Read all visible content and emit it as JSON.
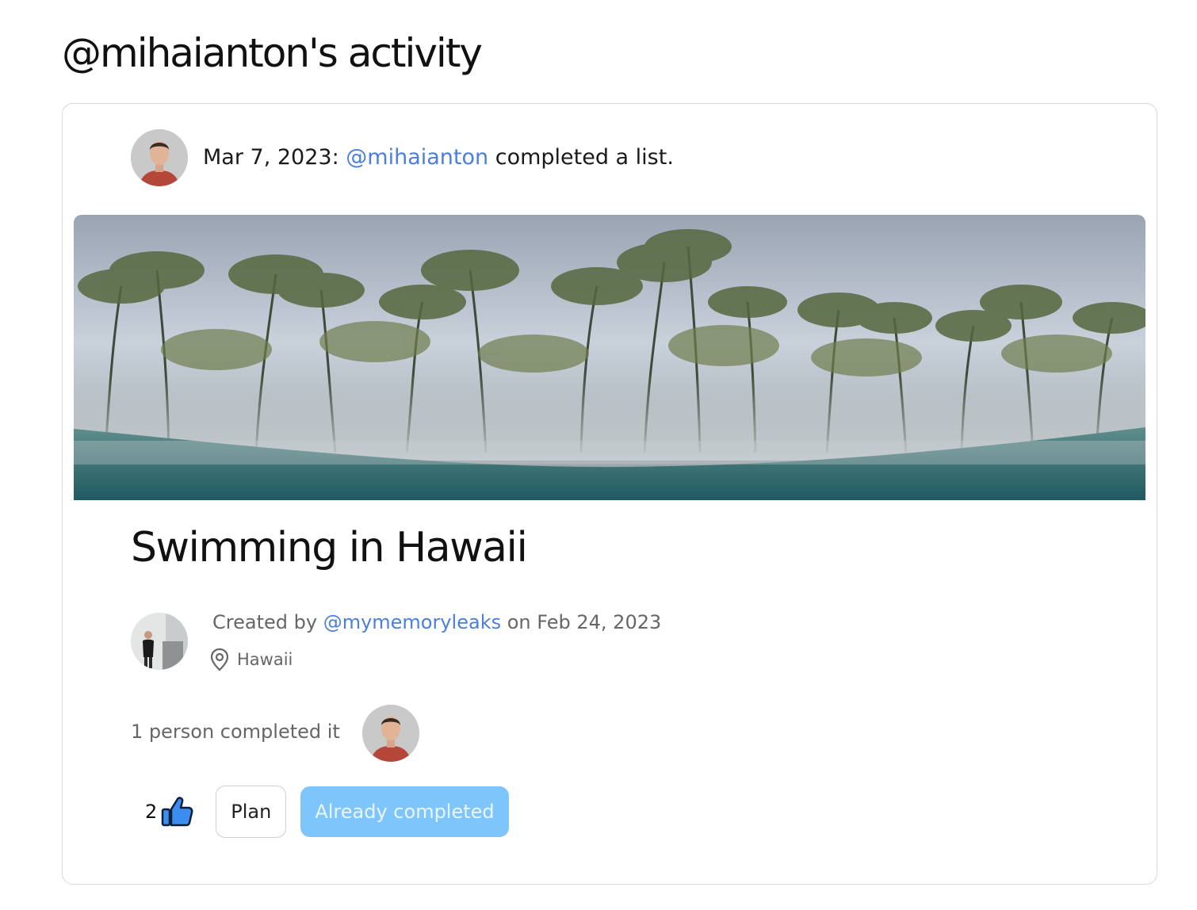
{
  "page": {
    "title": "@mihaianton's activity"
  },
  "activity": {
    "date": "Mar 7, 2023:",
    "user": "@mihaianton",
    "action": "completed a list."
  },
  "list": {
    "title": "Swimming in Hawaii",
    "created_prefix": "Created by",
    "creator": "@mymemoryleaks",
    "created_suffix": "on Feb 24, 2023",
    "location": "Hawaii",
    "location_icon": "map-pin-icon"
  },
  "completion": {
    "text": "1 person completed it"
  },
  "actions": {
    "like_count": "2",
    "like_icon": "thumbs-up-icon",
    "plan_label": "Plan",
    "completed_label": "Already completed"
  },
  "colors": {
    "link": "#4a7fe0",
    "completed_button_bg": "#7dc5fa",
    "thumb_fill": "#3b8ef0"
  }
}
